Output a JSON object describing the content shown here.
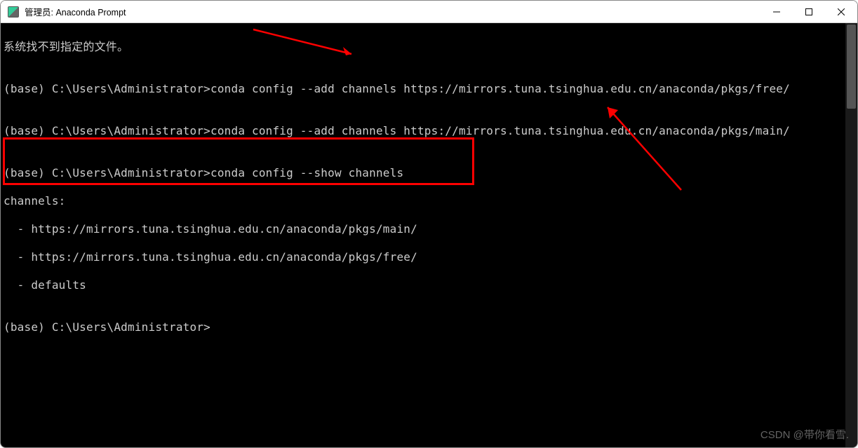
{
  "window": {
    "title": "管理员: Anaconda Prompt"
  },
  "terminal": {
    "line0": "系统找不到指定的文件。",
    "blank": "",
    "prompt1": "(base) C:\\Users\\Administrator>conda config --add channels https://mirrors.tuna.tsinghua.edu.cn/anaconda/pkgs/free/",
    "prompt2": "(base) C:\\Users\\Administrator>conda config --add channels https://mirrors.tuna.tsinghua.edu.cn/anaconda/pkgs/main/",
    "prompt3": "(base) C:\\Users\\Administrator>conda config --show channels",
    "channels_header": "channels:",
    "channel1": "  - https://mirrors.tuna.tsinghua.edu.cn/anaconda/pkgs/main/",
    "channel2": "  - https://mirrors.tuna.tsinghua.edu.cn/anaconda/pkgs/free/",
    "channel3": "  - defaults",
    "prompt4": "(base) C:\\Users\\Administrator>"
  },
  "watermark": "CSDN @带你看雪."
}
